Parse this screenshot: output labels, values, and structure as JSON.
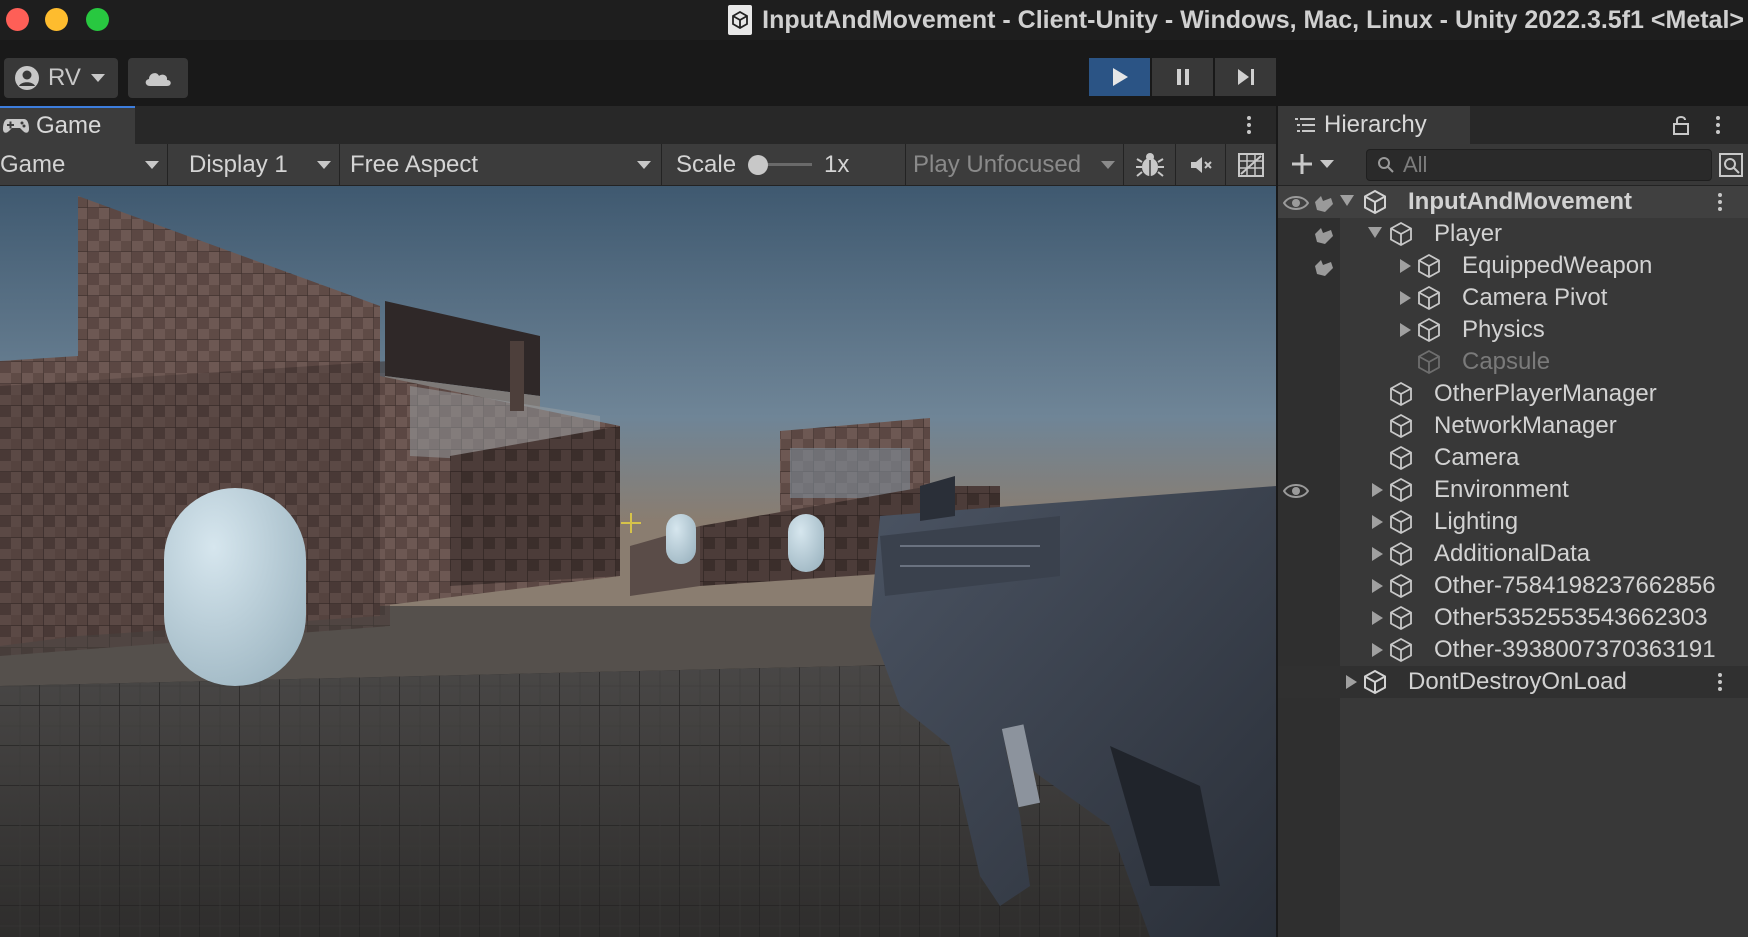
{
  "window": {
    "title": "InputAndMovement - Client-Unity - Windows, Mac, Linux - Unity 2022.3.5f1 <Metal>"
  },
  "toolbar": {
    "account_label": "RV",
    "cloud_icon": "cloud-icon",
    "play_active": true
  },
  "game_view": {
    "tab_label": "Game",
    "mode_select": "Game",
    "display_select": "Display 1",
    "aspect_select": "Free Aspect",
    "scale_label": "Scale",
    "scale_value": "1x",
    "play_focus_select": "Play Unfocused"
  },
  "hierarchy": {
    "tab_label": "Hierarchy",
    "search_placeholder": "All",
    "items": [
      {
        "label": "InputAndMovement",
        "type": "scene",
        "depth": 0,
        "expander": "down"
      },
      {
        "label": "Player",
        "type": "object",
        "depth": 1,
        "expander": "down"
      },
      {
        "label": "EquippedWeapon",
        "type": "object",
        "depth": 2,
        "expander": "right"
      },
      {
        "label": "Camera Pivot",
        "type": "object",
        "depth": 2,
        "expander": "right"
      },
      {
        "label": "Physics",
        "type": "object",
        "depth": 2,
        "expander": "right"
      },
      {
        "label": "Capsule",
        "type": "object",
        "depth": 2,
        "expander": "none",
        "inactive": true
      },
      {
        "label": "OtherPlayerManager",
        "type": "object",
        "depth": 1,
        "expander": "none"
      },
      {
        "label": "NetworkManager",
        "type": "object",
        "depth": 1,
        "expander": "none"
      },
      {
        "label": "Camera",
        "type": "object",
        "depth": 1,
        "expander": "none"
      },
      {
        "label": "Environment",
        "type": "object",
        "depth": 1,
        "expander": "right"
      },
      {
        "label": "Lighting",
        "type": "object",
        "depth": 1,
        "expander": "right"
      },
      {
        "label": "AdditionalData",
        "type": "object",
        "depth": 1,
        "expander": "right"
      },
      {
        "label": "Other-7584198237662856",
        "type": "object",
        "depth": 1,
        "expander": "right"
      },
      {
        "label": "Other5352553543662303",
        "type": "object",
        "depth": 1,
        "expander": "right"
      },
      {
        "label": "Other-3938007370363191",
        "type": "object",
        "depth": 1,
        "expander": "right"
      },
      {
        "label": "DontDestroyOnLoad",
        "type": "scene",
        "depth": 0,
        "expander": "right"
      }
    ]
  },
  "colors": {
    "accent": "#3d7ede",
    "play_active": "#2b5485"
  }
}
